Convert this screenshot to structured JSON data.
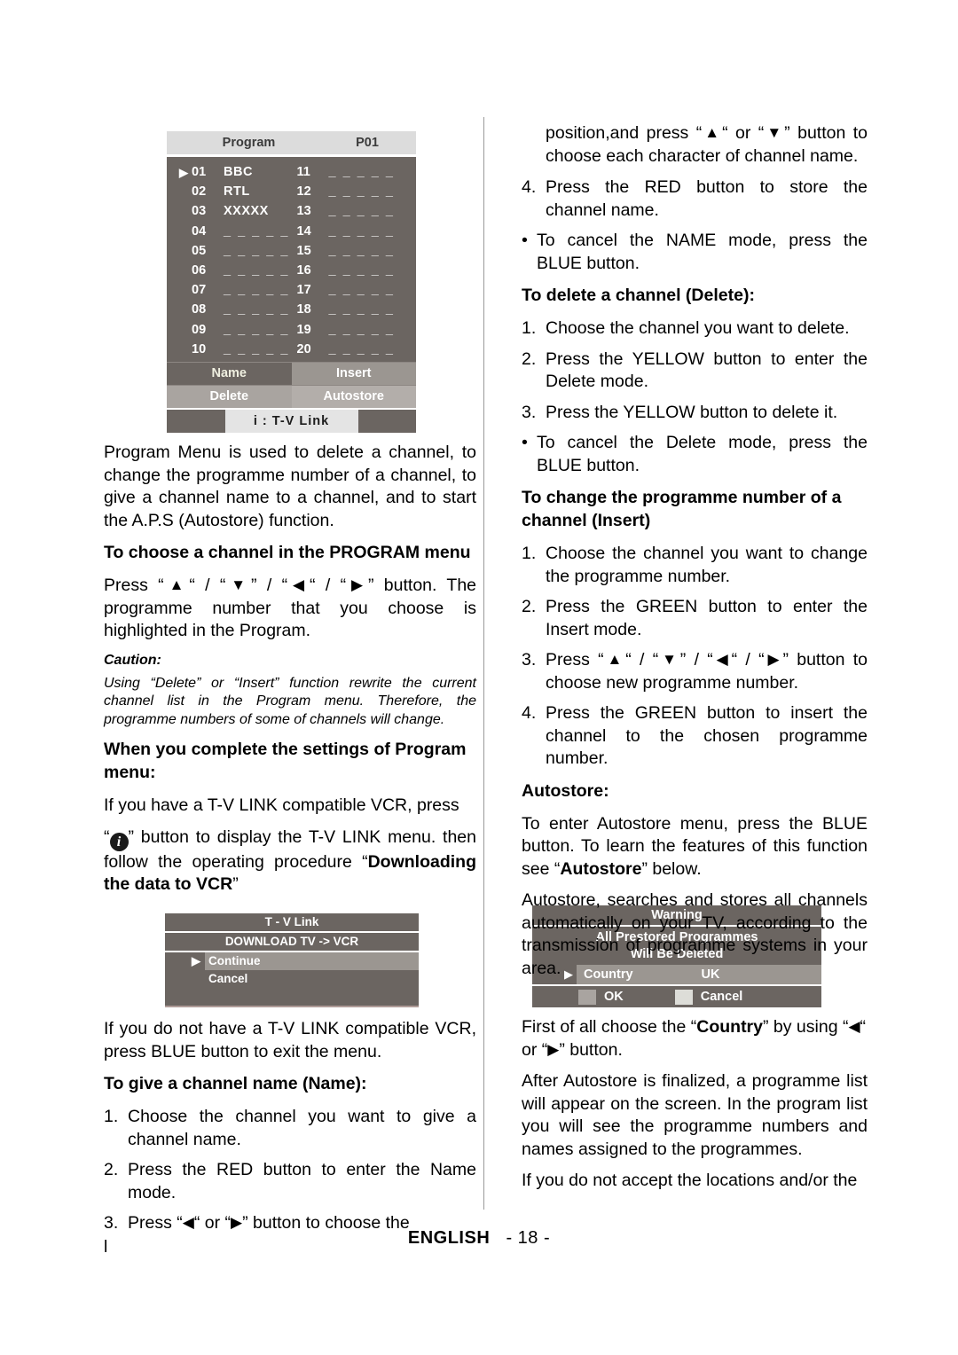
{
  "footer": {
    "language": "ENGLISH",
    "page": "- 18 -"
  },
  "program_osd": {
    "title": "Program",
    "program_number": "P01",
    "cursor_glyph": "▶",
    "empty_name": "_ _ _ _ _",
    "left_column": [
      {
        "no": "01",
        "name": "BBC",
        "selected": true
      },
      {
        "no": "02",
        "name": "RTL",
        "selected": false
      },
      {
        "no": "03",
        "name": "XXXXX",
        "selected": false
      },
      {
        "no": "04",
        "name": "",
        "selected": false
      },
      {
        "no": "05",
        "name": "",
        "selected": false
      },
      {
        "no": "06",
        "name": "",
        "selected": false
      },
      {
        "no": "07",
        "name": "",
        "selected": false
      },
      {
        "no": "08",
        "name": "",
        "selected": false
      },
      {
        "no": "09",
        "name": "",
        "selected": false
      },
      {
        "no": "10",
        "name": "",
        "selected": false
      }
    ],
    "right_column": [
      {
        "no": "11",
        "name": ""
      },
      {
        "no": "12",
        "name": ""
      },
      {
        "no": "13",
        "name": ""
      },
      {
        "no": "14",
        "name": ""
      },
      {
        "no": "15",
        "name": ""
      },
      {
        "no": "16",
        "name": ""
      },
      {
        "no": "17",
        "name": ""
      },
      {
        "no": "18",
        "name": ""
      },
      {
        "no": "19",
        "name": ""
      },
      {
        "no": "20",
        "name": ""
      }
    ],
    "buttons": {
      "name": "Name",
      "insert": "Insert",
      "delete": "Delete",
      "autostore": "Autostore"
    },
    "footer_hint": "i :  T-V Link",
    "colors": {
      "panel_bg": "#6b6561",
      "title_bg": "#dcdcdc",
      "title_fg": "#3b3b3b",
      "btn_insert": "#9b9691",
      "btn_delete": "#a9a4a0",
      "btn_autostore": "#b3aeaa",
      "hint_bg": "#e4e4e4"
    }
  },
  "tvlink_osd": {
    "title": "T - V Link",
    "subtitle": "DOWNLOAD TV -> VCR",
    "cursor_glyph": "▶",
    "items": [
      {
        "label": "Continue",
        "selected": true
      },
      {
        "label": "Cancel",
        "selected": false
      }
    ],
    "colors": {
      "panel_bg": "#6b6561",
      "highlight_bg": "#9b9691"
    }
  },
  "warning_osd": {
    "title": "Warning",
    "message_line1": "All Prestored  Programmes",
    "message_line2": "Will Be Deleted",
    "cursor_glyph": "▶",
    "country_label": "Country",
    "country_value": "UK",
    "ok_label": "OK",
    "cancel_label": "Cancel",
    "colors": {
      "panel_bg": "#6b6561",
      "field_bg": "#9b9691",
      "ok_chip": "#a9a4a0",
      "cancel_chip": "#ddddd8"
    }
  },
  "left_column": {
    "intro": "Program Menu is used to delete a channel, to change the programme number of a channel, to give a channel name to a channel, and to start the A.P.S (Autostore) function.",
    "heading_choose": "To choose a channel in the PROGRAM menu",
    "press_prefix": " Press “",
    "press_mid1": "“ / “",
    "press_mid2": "” / “",
    "press_mid3": "“ / “",
    "press_suffix": "” button. The programme number that you choose is highlighted in the Program.",
    "caution_label": "Caution:",
    "caution_text": "Using “Delete” or “Insert” function rewrite the current channel list in the Program menu. Therefore, the programme numbers of some of channels will change.",
    "heading_complete": "When you complete the settings of Program menu:",
    "tvlink_para_1": "If you have a T-V LINK compatible VCR, press",
    "tvlink_para_2a": "” button to display the T-V LINK menu. then follow the operating procedure “",
    "tvlink_bold_1": "Downloading the data to VCR",
    "tvlink_para_2b": "”",
    "no_tvlink": "If you do not have a T-V LINK compatible VCR, press BLUE button to exit the menu.",
    "heading_name": "To give a channel name (Name):",
    "name_steps": [
      {
        "num": "1.",
        "text": "Choose the channel you want to give a channel name."
      },
      {
        "num": "2.",
        "text": "Press the RED button to enter the Name mode."
      }
    ],
    "step3_num": "3.",
    "step3_a": "Press “",
    "step3_b": "“ or “",
    "step3_c": "” button to choose the",
    "step3_tail": "l"
  },
  "right_column": {
    "cont_a": "position,and press “",
    "cont_b": "“ or “",
    "cont_c": "” button to choose each character of channel name.",
    "step4": {
      "num": "4.",
      "text": "Press the RED button to store the channel name."
    },
    "bullet_name": {
      "num": "•",
      "text": "To cancel the NAME mode, press the BLUE button."
    },
    "heading_delete": "To delete a channel (Delete):",
    "delete_steps": [
      {
        "num": "1.",
        "text": "Choose the channel you want to delete."
      },
      {
        "num": "2.",
        "text": "Press the YELLOW button to enter the Delete mode."
      },
      {
        "num": "3.",
        "text": "Press the YELLOW button to delete it."
      }
    ],
    "bullet_delete": {
      "num": "•",
      "text": "To cancel the Delete mode, press the BLUE button."
    },
    "heading_insert": "To change the programme number of a channel (Insert)",
    "insert_steps": [
      {
        "num": "1.",
        "text": "Choose the channel you want to change the programme number."
      },
      {
        "num": "2.",
        "text": "Press the GREEN button to enter the Insert mode."
      }
    ],
    "insert_step3_num": "3.",
    "insert_step3_a": " Press “",
    "insert_step3_b": "“ / “",
    "insert_step3_c": "” / “",
    "insert_step3_d": "“ / “",
    "insert_step3_e": "” button to choose new programme number.",
    "insert_step4": {
      "num": "4.",
      "text": "Press the GREEN button to insert the channel to the chosen programme number."
    },
    "heading_autostore": "Autostore:",
    "autostore_p1a": "To enter Autostore menu, press the BLUE button. To learn the features of this function see “",
    "autostore_p1_bold": "Autostore",
    "autostore_p1b": "” below.",
    "autostore_p2": "Autostore, searches and stores all channels automatically on your TV, according to the transmission of programme systems in your area.",
    "country_a": "First of all choose the “",
    "country_bold": "Country",
    "country_b": "” by using “",
    "country_c": "“",
    "country_d": "or “",
    "country_e": "” button.",
    "after_autostore": "After Autostore is finalized, a programme list will appear on the screen. In the program list you will see the programme numbers and names assigned to the programmes.",
    "last_line": "If you do not accept the locations and/or the"
  },
  "glyphs": {
    "up": "▲",
    "down": "▼",
    "left": "◀",
    "right": "▶",
    "info": "i"
  }
}
